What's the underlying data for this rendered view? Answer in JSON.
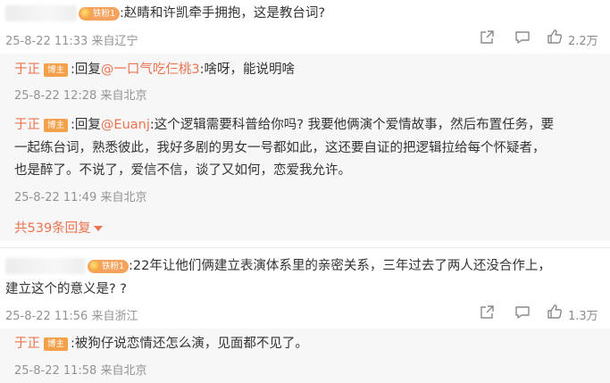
{
  "comments": [
    {
      "fan_badge": "铁粉1",
      "text": ":赵睛和许凯牵手拥抱，这是教台词?",
      "time": "25-8-22 11:33",
      "source": "来自辽宁",
      "like_count": "2.2万",
      "replies": [
        {
          "author": "于正",
          "role_badge": "博主",
          "prefix": ":回复",
          "mention": "@一口气吃仨桃3",
          "text": ":啥呀，能说明啥",
          "time": "25-8-22 12:28",
          "source": "来自北京"
        },
        {
          "author": "于正",
          "role_badge": "博主",
          "prefix": ":回复",
          "mention": "@Euanj",
          "text_line1": ":这个逻辑需要科普给你吗? 我要他俩演个爱情故事，然后布置任务，要",
          "text_line2": "一起练台词，熟悉彼此，我好多剧的男女一号都如此，这还要自证的把逻辑拉给每个怀疑者，",
          "text_line3": "也是醉了。不说了，爱信不信，谈了又如何，恋爱我允许。",
          "time": "25-8-22 11:49",
          "source": "来自北京"
        }
      ],
      "more_replies": "共539条回复"
    },
    {
      "fan_badge": "铁粉1",
      "text_line1": ":22年让他们俩建立表演体系里的亲密关系，三年过去了两人还没合作上，",
      "text_line2": "建立这个的意义是? ?",
      "time": "25-8-22 11:56",
      "source": "来自浙江",
      "like_count": "1.3万",
      "replies": [
        {
          "author": "于正",
          "role_badge": "博主",
          "text": ":被狗仔说恋情还怎么演，见面都不见了。",
          "time": "25-8-22 11:58",
          "source": "来自北京"
        }
      ]
    }
  ]
}
